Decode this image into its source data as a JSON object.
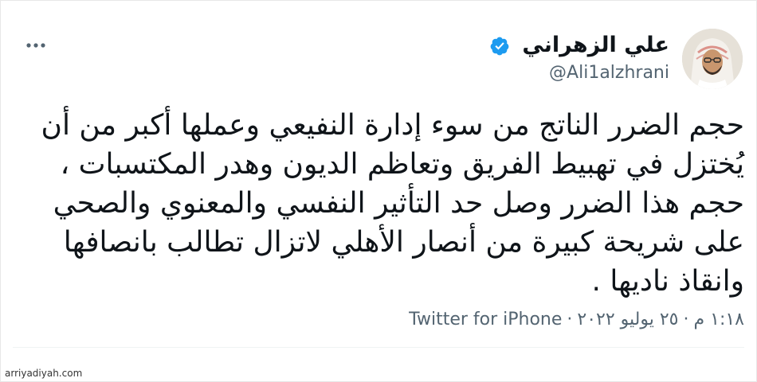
{
  "tweet": {
    "author": {
      "display_name": "علي الزهراني",
      "handle": "@Ali1alzhrani",
      "verified": true,
      "avatar": "profile-photo"
    },
    "more_icon": "more-horizontal-icon",
    "text_lines": [
      "حجم الضرر الناتج من سوء إدارة النفيعي وعملها أكبر من أن",
      "يُختزل في تهبيط الفريق وتعاظم الديون وهدر المكتسبات ،",
      "حجم هذا الضرر وصل حد التأثير النفسي والمعنوي والصحي",
      "على شريحة كبيرة من أنصار الأهلي لاتزال تطالب بانصافها",
      "وانقاذ ناديها ."
    ],
    "time": "١:١٨ م",
    "date": "٢٥ يوليو ٢٠٢٢",
    "source": "Twitter for iPhone",
    "separator": "·"
  },
  "watermark": "arriyadiyah.com",
  "colors": {
    "text": "#0f1419",
    "secondary": "#536471",
    "verified": "#1d9bf0"
  }
}
